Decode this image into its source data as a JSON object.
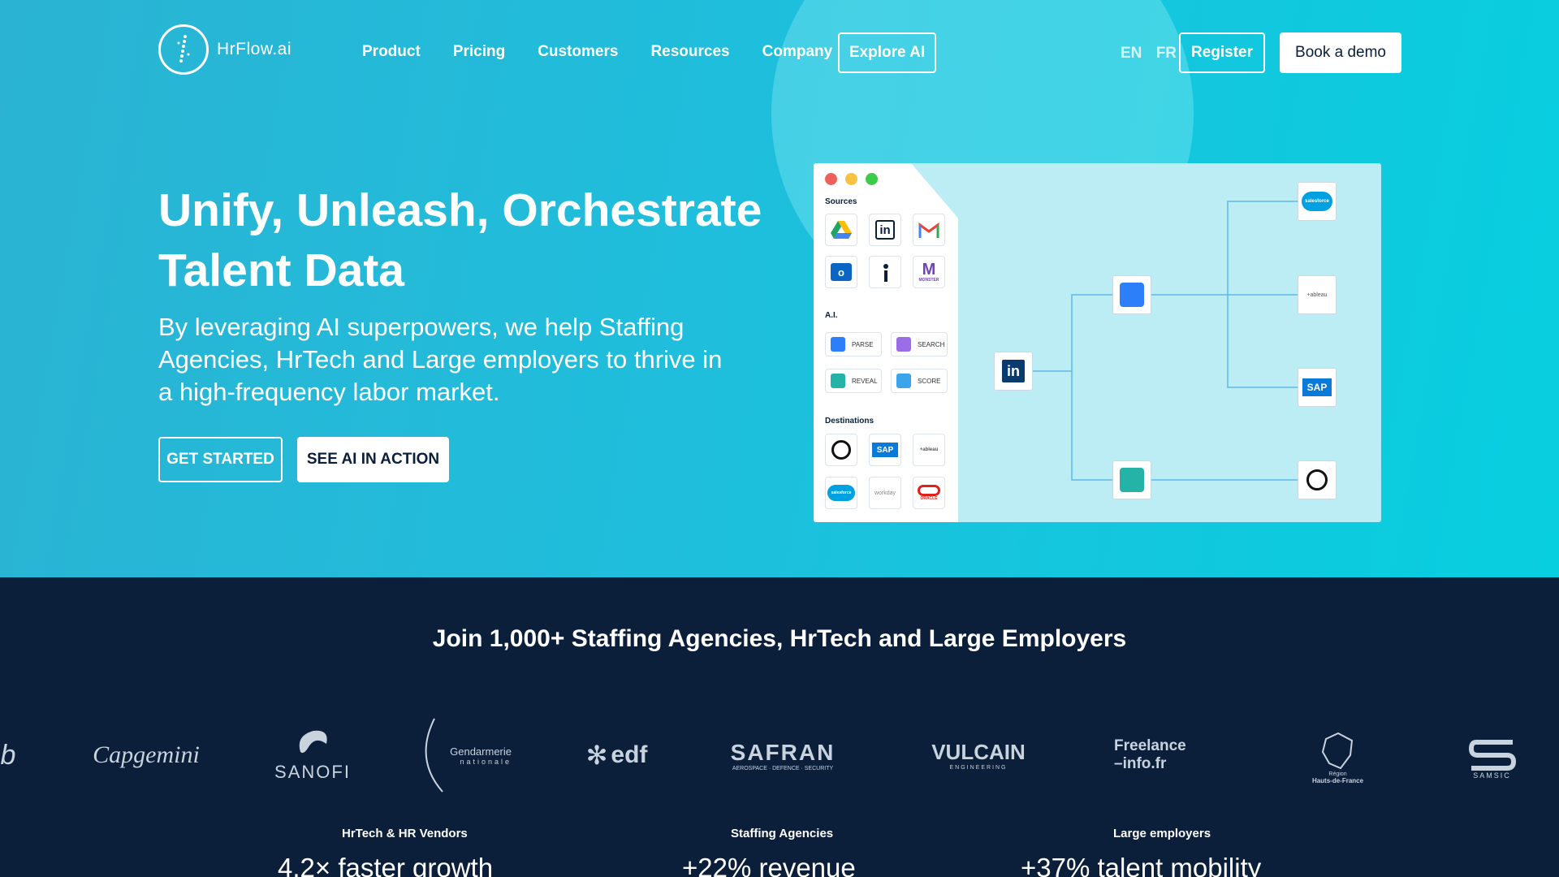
{
  "brand": {
    "name": "HrFlow.ai"
  },
  "nav": {
    "items": [
      "Product",
      "Pricing",
      "Customers",
      "Resources",
      "Company"
    ],
    "explore": "Explore AI",
    "languages": [
      "EN",
      "FR"
    ],
    "register": "Register",
    "demo": "Book a demo"
  },
  "hero": {
    "title_line1": "Unify, Unleash, Orchestrate",
    "title_line2": "Talent Data",
    "subtitle": "By leveraging AI superpowers, we help Staffing Agencies, HrTech and Large employers to thrive in a high-frequency labor market.",
    "cta_primary": "GET STARTED",
    "cta_secondary": "SEE AI IN ACTION"
  },
  "illustration": {
    "sources_label": "Sources",
    "ai_label": "A.I.",
    "destinations_label": "Destinations",
    "ai_chips": [
      "PARSE",
      "SEARCH",
      "REVEAL",
      "SCORE"
    ],
    "source_icons": [
      "google-drive",
      "linkedin",
      "gmail",
      "outlook",
      "indeed",
      "monster"
    ],
    "destination_icons": [
      "mailchimp",
      "sap",
      "tableau",
      "salesforce",
      "workday",
      "oracle"
    ],
    "flow_nodes": [
      "linkedin",
      "parse",
      "reveal",
      "salesforce",
      "tableau",
      "sap",
      "mailchimp"
    ],
    "sap_text": "SAP",
    "salesforce_text": "salesforce",
    "tableau_text": "+ableau",
    "workday_text": "workday",
    "oracle_text": "ORACLE",
    "monster_text": "MONSTER",
    "colors": {
      "dot_red": "#f0605a",
      "dot_yellow": "#f7c242",
      "dot_green": "#3ccb4a"
    }
  },
  "trust": {
    "heading": "Join 1,000+ Staffing Agencies, HrTech and Large Employers",
    "logos": [
      "Capgemini",
      "SANOFI",
      "Gendarmerie nationale",
      "EDF",
      "SAFRAN",
      "VULCAIN",
      "Freelance-info.fr",
      "Région Hauts-de-France",
      "SAMSIC"
    ],
    "logo_texts": {
      "capgemini": "Capgemini",
      "sanofi": "SANOFI",
      "gendarmerie_line1": "Gendarmerie",
      "gendarmerie_line2": "nationale",
      "edf": "edf",
      "safran": "SAFRAN",
      "safran_tag": "AEROSPACE · DEFENCE · SECURITY",
      "vulcain": "VULCAIN",
      "vulcain_tag": "ENGINEERING",
      "freelance_line1": "Freelance",
      "freelance_line2": "–info.fr",
      "region_line1": "Région",
      "region_line2": "Hauts-de-France",
      "samsic": "SAMSIC"
    }
  },
  "stats": [
    {
      "label": "HrTech & HR Vendors",
      "value": "4.2× faster growth"
    },
    {
      "label": "Staffing Agencies",
      "value": "+22% revenue"
    },
    {
      "label": "Large employers",
      "value": "+37% talent mobility"
    }
  ],
  "colors": {
    "hero_start": "#2bb3d3",
    "hero_end": "#07cfe0",
    "dark_bg": "#0b1e3a",
    "linkedin": "#0a66c2",
    "accent_blue": "#2d7ff9"
  }
}
